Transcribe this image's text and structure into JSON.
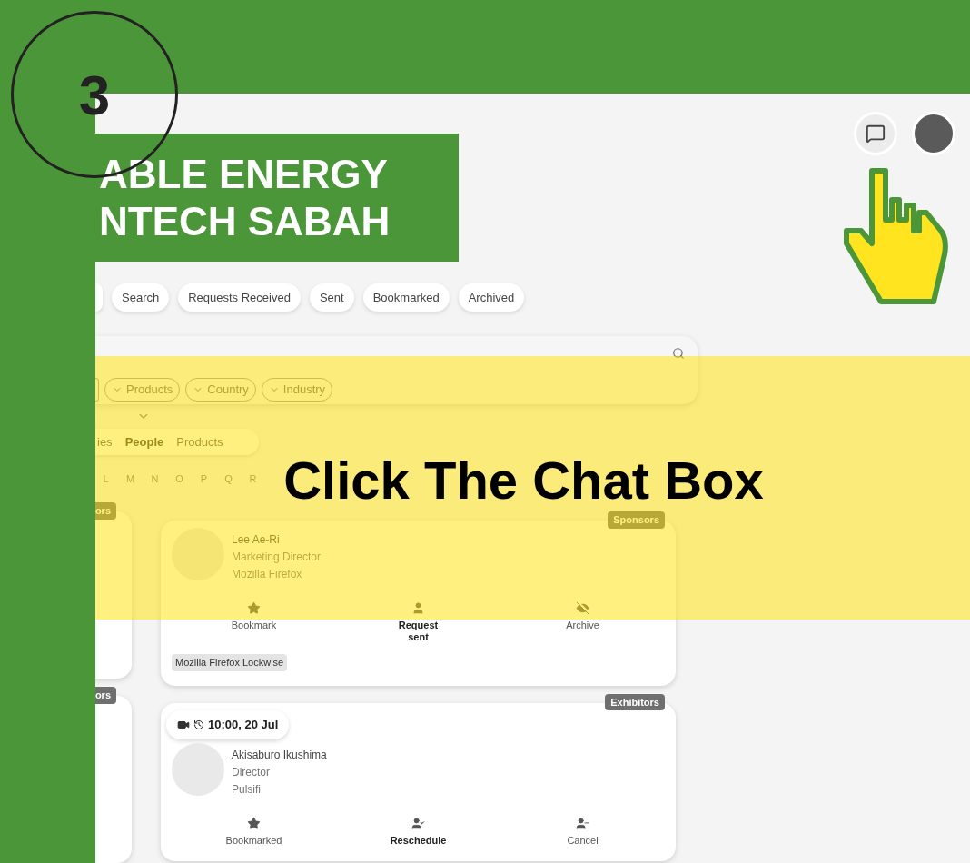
{
  "step": {
    "number": "3"
  },
  "callout": {
    "text": "Click The Chat Box"
  },
  "header": {
    "logo_lines": [
      "ABLE ENERGY",
      "NTECH SABAH"
    ]
  },
  "tabs": [
    {
      "label": "Search",
      "selected": false
    },
    {
      "label": "Requests Received",
      "selected": false
    },
    {
      "label": "Sent",
      "selected": false
    },
    {
      "label": "Bookmarked",
      "selected": false
    },
    {
      "label": "Archived",
      "selected": false
    }
  ],
  "filters": [
    "Products",
    "Country",
    "Industry"
  ],
  "view_toggle": [
    {
      "label": "ies",
      "selected": false
    },
    {
      "label": "People",
      "selected": true
    },
    {
      "label": "Products",
      "selected": false
    }
  ],
  "alphabet": [
    "L",
    "M",
    "N",
    "O",
    "P",
    "Q",
    "R"
  ],
  "side_cards": [
    {
      "tag": "ors"
    },
    {
      "tag": "ors"
    }
  ],
  "cards": [
    {
      "tag": "Sponsors",
      "name": "Lee Ae-Ri",
      "role": "Marketing Director",
      "company": "Mozilla Firefox",
      "actions": [
        {
          "kind": "star",
          "label": "Bookmark",
          "emphasized": false
        },
        {
          "kind": "request",
          "label": "Request sent",
          "emphasized": true
        },
        {
          "kind": "archive",
          "label": "Archive",
          "emphasized": false
        }
      ],
      "products": [
        "Mozilla Firefox Lockwise"
      ]
    },
    {
      "tag": "Exhibitors",
      "meeting": "10:00, 20 Jul",
      "name": "Akisaburo Ikushima",
      "role": "Director",
      "company": "Pulsifi",
      "actions": [
        {
          "kind": "star",
          "label": "Bookmarked",
          "emphasized": false
        },
        {
          "kind": "reschedule",
          "label": "Reschedule",
          "emphasized": true
        },
        {
          "kind": "cancel",
          "label": "Cancel",
          "emphasized": false
        }
      ]
    }
  ]
}
